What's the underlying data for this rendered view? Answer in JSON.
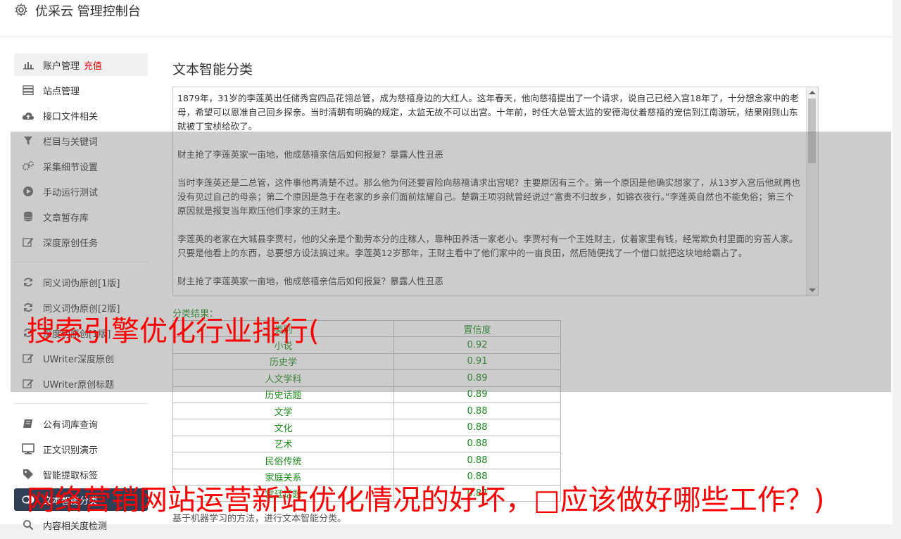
{
  "header": {
    "title": "优采云 管理控制台"
  },
  "sidebar": {
    "items": [
      {
        "label": "账户管理",
        "badge": "充值",
        "icon": "bar-chart-icon",
        "active": true
      },
      {
        "label": "站点管理",
        "icon": "server-icon"
      },
      {
        "label": "接口文件相关",
        "icon": "cloud-upload-icon"
      },
      {
        "label": "栏目与关键词",
        "icon": "filter-icon"
      },
      {
        "label": "采集细节设置",
        "icon": "gears-icon"
      },
      {
        "label": "手动运行测试",
        "icon": "play-circle-icon"
      },
      {
        "label": "文章暂存库",
        "icon": "database-icon"
      },
      {
        "label": "深度原创任务",
        "icon": "edit-icon"
      }
    ],
    "group2": [
      {
        "label": "同义词伪原创[1版]",
        "icon": "refresh-icon"
      },
      {
        "label": "同义词伪原创[2版]",
        "icon": "refresh-icon"
      },
      {
        "label": "深度伪原创[1版]",
        "icon": "refresh-icon"
      },
      {
        "label": "UWriter深度原创",
        "icon": "edit-icon"
      },
      {
        "label": "UWriter原创标题",
        "icon": "edit-icon"
      }
    ],
    "group3": [
      {
        "label": "公有词库查询",
        "icon": "book-icon"
      },
      {
        "label": "正文识别演示",
        "icon": "monitor-icon"
      },
      {
        "label": "智能提取标签",
        "icon": "tag-icon"
      },
      {
        "label": "文本智能分类",
        "icon": "toggle-icon"
      },
      {
        "label": "内容相关度检测",
        "icon": "search-icon"
      }
    ]
  },
  "main": {
    "title": "文本智能分类",
    "text": "1879年，31岁的李莲英出任储秀宫四品花翎总管，成为慈禧身边的大红人。这年春天，他向慈禧提出了一个请求，说自己已经入宫18年了，十分想念家中的老母，希望可以恩准自己回乡探亲。当时清朝有明确的规定，太监无故不可以出宫。十年前，时任大总管太监的安德海仗着慈禧的宠信到江南游玩，结果刚到山东就被丁宝桢给砍了。\n\n财主抢了李莲英家一亩地，他成慈禧亲信后如何报复？暴露人性丑恶\n\n当时李莲英还是二总管，这件事他再清楚不过。那么他为何还要冒险向慈禧请求出宫呢？主要原因有三个。第一个原因是他确实想家了，从13岁入宫后他就再也没有见过自己的母亲；第二个原因是急于在老家的乡亲们面前炫耀自己。楚霸王项羽就曾经说过“富贵不归故乡，如锦衣夜行。”李莲英自然也不能免俗；第三个原因就是报复当年欺压他们李家的王财主。\n\n李莲英的老家在大城县李贾村，他的父亲是个勤劳本分的庄稼人，靠种田养活一家老小。李贾村有一个王姓财主，仗着家里有钱，经常欺负村里面的穷苦人家。只要是他看上的东西，总要想方设法搞过来。李莲英12岁那年，王财主看中了他们家中的一亩良田，然后随便找了一个借口就把这块地给霸占了。\n\n财主抢了李莲英家一亩地，他成慈禧亲信后如何报复？暴露人性丑恶",
    "result_label": "分类结果：",
    "columns": [
      "类别",
      "置信度"
    ],
    "rows": [
      [
        "小说",
        "0.92"
      ],
      [
        "历史学",
        "0.91"
      ],
      [
        "人文学科",
        "0.89"
      ],
      [
        "历史话题",
        "0.89"
      ],
      [
        "文学",
        "0.88"
      ],
      [
        "文化",
        "0.88"
      ],
      [
        "艺术",
        "0.88"
      ],
      [
        "民俗传统",
        "0.88"
      ],
      [
        "家庭关系",
        "0.88"
      ],
      [
        "宫廷话题",
        "0.87"
      ]
    ],
    "footer": "基于机器学习的方法，进行文本智能分类。"
  },
  "overlay": {
    "line1": "搜索引擎优化行业排行(",
    "line2": "网络营销网站运营新站优化情况的好坏，□应该做好哪些工作？)"
  },
  "colors": {
    "accent_red": "#e00000",
    "result_green": "#1a8a1a",
    "active_dark": "#2f3f56"
  }
}
